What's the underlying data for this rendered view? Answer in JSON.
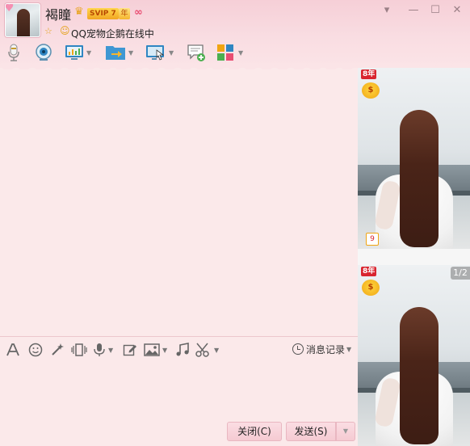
{
  "profile": {
    "name": "褐瞳",
    "vip_label": "SVIP 7",
    "year_label": "年",
    "status_text": "QQ宠物企鹅在线中"
  },
  "window_controls": {
    "dropdown": "▾",
    "minimize": "—",
    "maximize": "☐",
    "close": "✕"
  },
  "toolbar": {
    "icons": [
      "microphone-icon",
      "video-call-icon",
      "screen-share-icon",
      "file-transfer-icon",
      "remote-desktop-icon",
      "message-add-icon",
      "apps-icon"
    ]
  },
  "input_toolbar": {
    "icons": [
      "font-icon",
      "emoji-icon",
      "magic-icon",
      "shake-icon",
      "voice-icon",
      "edit-icon",
      "image-icon",
      "music-icon",
      "screenshot-icon"
    ],
    "history_label": "消息记录"
  },
  "buttons": {
    "close_label": "关闭(C)",
    "send_label": "发送(S)"
  },
  "right_pane": {
    "year_badge": "8年",
    "page_indicator": "1/2",
    "thumb_badge": "9"
  },
  "colors": {
    "accent_pink": "#f6cfd7",
    "background": "#fbe9ea",
    "vip_gold": "#f2a622"
  }
}
